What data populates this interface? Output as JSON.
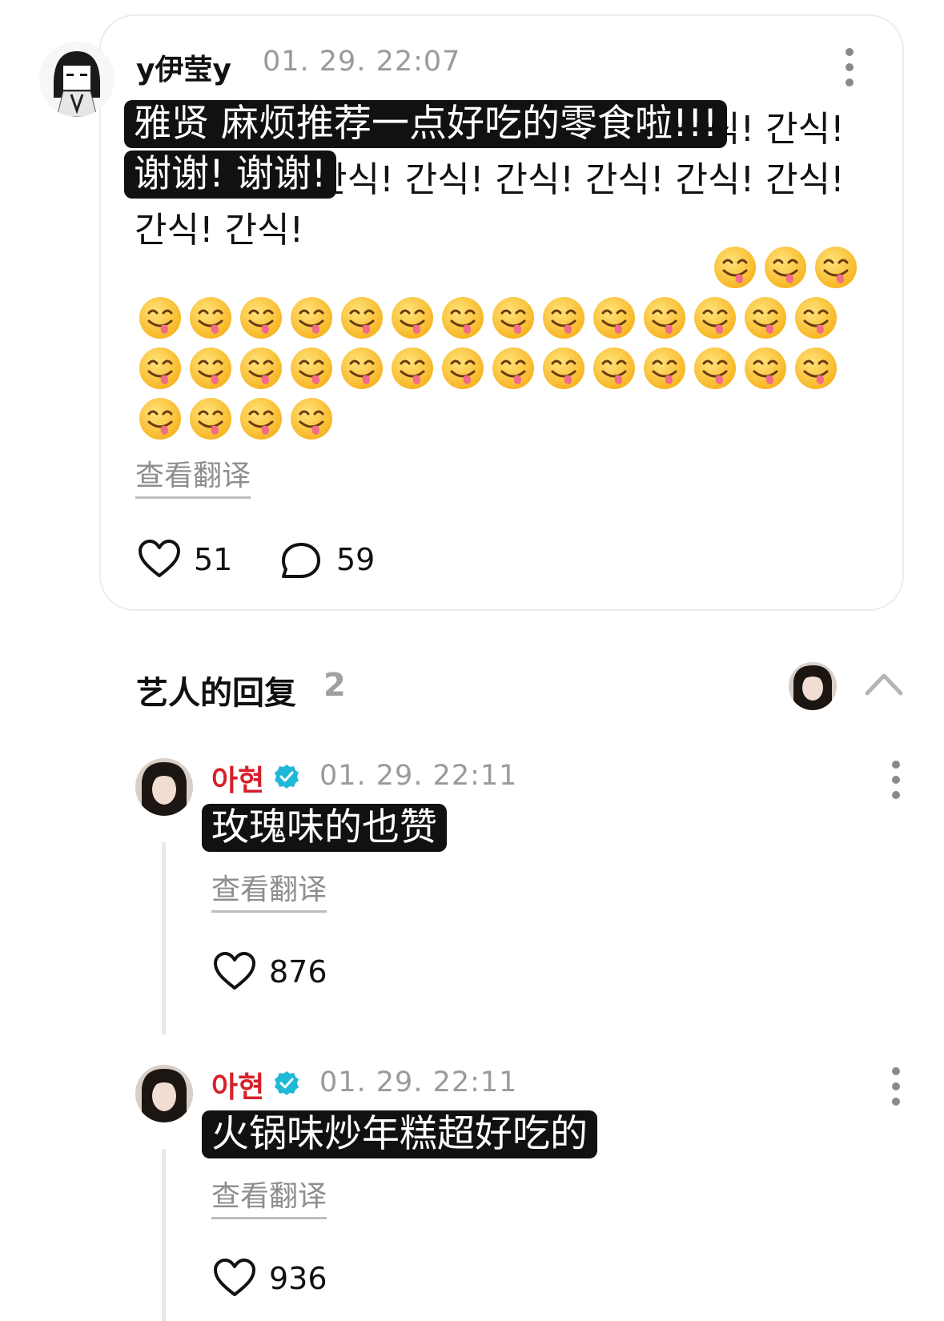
{
  "post": {
    "username": "y伊莹y",
    "time": "01. 29. 22:07",
    "text_background": "간식! 간식! 간식! 간식! 간식! 간식! 간식! 간식! 간식! 간식! 간식! 간식! 간식! 간식! 간식! 간식! 간식! 간식!",
    "overlay_lines": [
      "雅贤 麻烦推荐一点好吃的零食啦!!!",
      "谢谢! 谢谢!"
    ],
    "emoji_icon": "yum-face-emoji",
    "translate_label": "查看翻译",
    "likes": "51",
    "comments": "59"
  },
  "artist_section": {
    "title": "艺人的回复",
    "count": "2"
  },
  "replies": [
    {
      "name": "아현",
      "verified": true,
      "time": "01. 29. 22:11",
      "text": "玫瑰味的也赞",
      "translate_label": "查看翻译",
      "likes": "876"
    },
    {
      "name": "아현",
      "verified": true,
      "time": "01. 29. 22:11",
      "text": "火锅味炒年糕超好吃的",
      "translate_label": "查看翻译",
      "likes": "936"
    }
  ],
  "colors": {
    "artist_name": "#d6202a",
    "verified_badge": "#1fb8d6",
    "overlay_bg": "#111111"
  }
}
